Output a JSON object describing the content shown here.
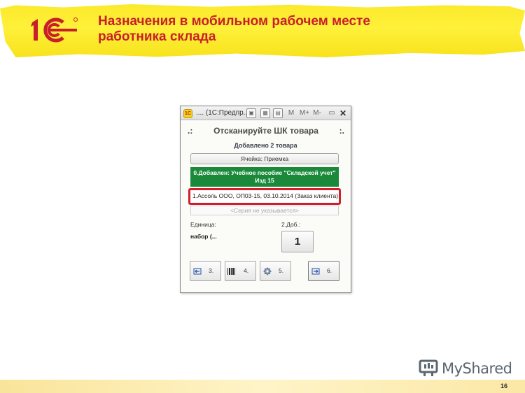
{
  "slide": {
    "title": "Назначения в мобильном рабочем месте работника склада",
    "logo_text": "1С",
    "page_number": "16"
  },
  "window": {
    "title": ".... (1С:Предпр...",
    "toolbar_m": "M",
    "toolbar_mplus": "M+",
    "toolbar_mminus": "M-",
    "app_icon": "1C",
    "icons": [
      "app-icon",
      "save-icon",
      "calculator-icon",
      "calendar-icon",
      "minimize-icon",
      "close-icon"
    ]
  },
  "form": {
    "scan_prompt_left": ".:",
    "scan_prompt": "Отсканируйте ШК товара",
    "scan_prompt_right": ":.",
    "added_count": "Добавлено 2 товара",
    "cell_button": "Ячейка: Приемка",
    "item_line": "0.Добавлен: Учебное пособие \"Складской учет\" Изд 15",
    "document_line": "1.Ассоль ООО, ОП03-15, 03.10.2014 (Заказ клиента)",
    "series_placeholder": "<Серия не указывается>",
    "unit_label": "Единица:",
    "unit_value": "набор (...",
    "qty_label": "2.Доб.:",
    "qty_value": "1",
    "buttons": [
      {
        "label": "3.",
        "icon": "back-arrow-icon"
      },
      {
        "label": "4.",
        "icon": "barcode-icon"
      },
      {
        "label": "5.",
        "icon": "gear-icon"
      },
      {
        "label": "6.",
        "icon": "forward-icon"
      }
    ]
  },
  "watermark": {
    "text": "MyShared"
  },
  "colors": {
    "title_red": "#c8202a",
    "header_yellow": "#fff03a",
    "highlight_green": "#1a8a3a",
    "frame_red": "#d11e2a"
  }
}
